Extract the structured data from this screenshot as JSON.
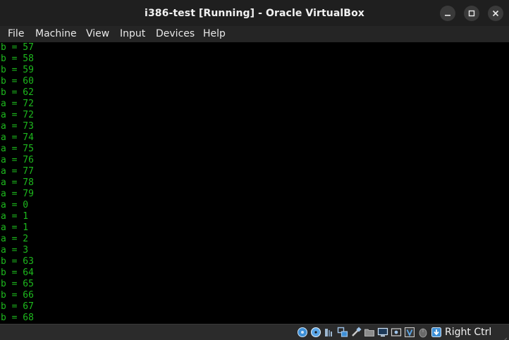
{
  "window": {
    "title": "i386-test [Running] - Oracle VirtualBox",
    "controls": [
      "minimize-icon",
      "maximize-icon",
      "close-icon"
    ]
  },
  "menubar": {
    "items": [
      {
        "label": "File"
      },
      {
        "label": "Machine"
      },
      {
        "label": "View"
      },
      {
        "label": "Input"
      },
      {
        "label": "Devices"
      },
      {
        "label": "Help"
      }
    ]
  },
  "console": {
    "lines": [
      "b = 57",
      "b = 58",
      "b = 59",
      "b = 60",
      "b = 62",
      "a = 72",
      "a = 72",
      "a = 73",
      "a = 74",
      "a = 75",
      "a = 76",
      "a = 77",
      "a = 78",
      "a = 79",
      "a = 0",
      "a = 1",
      "a = 1",
      "a = 2",
      "a = 3",
      "b = 63",
      "b = 64",
      "b = 65",
      "b = 66",
      "b = 67",
      "b = 68"
    ],
    "text_color": "#1db81d"
  },
  "statusbar": {
    "icons": [
      "hard-disk-icon",
      "optical-drive-icon",
      "audio-icon",
      "network-icon",
      "usb-icon",
      "shared-folders-icon",
      "display-icon",
      "recording-icon",
      "virtualization-icon",
      "mouse-integration-icon",
      "keyboard-capture-icon"
    ],
    "host_key": "Right Ctrl"
  },
  "colors": {
    "titlebar_bg": "#1f1f1f",
    "menubar_bg": "#252525",
    "display_bg": "#000000",
    "statusbar_bg": "#2b2b2b",
    "accent_blue": "#3d8fd6"
  }
}
